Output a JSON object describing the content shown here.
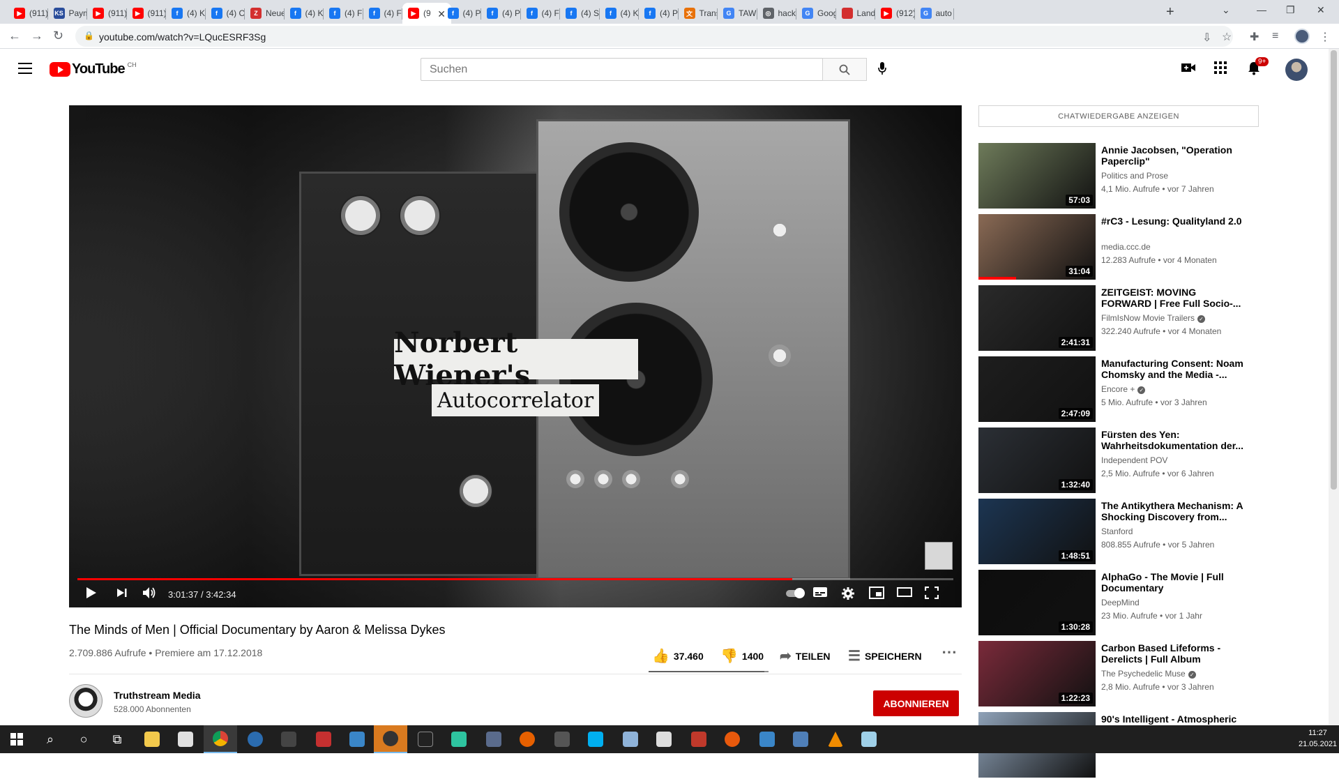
{
  "browser": {
    "tabs": [
      {
        "label": "(911)",
        "icon": "youtube",
        "color": "#ff0000"
      },
      {
        "label": "Paym",
        "icon": "ks",
        "color": "#2a4d9b"
      },
      {
        "label": "(911)",
        "icon": "youtube",
        "color": "#ff0000"
      },
      {
        "label": "(911)",
        "icon": "youtube",
        "color": "#ff0000"
      },
      {
        "label": "(4) Kı",
        "icon": "facebook",
        "color": "#1877f2"
      },
      {
        "label": "(4) Cı",
        "icon": "facebook",
        "color": "#1877f2"
      },
      {
        "label": "Neue",
        "icon": "z",
        "color": "#d32f2f"
      },
      {
        "label": "(4) Kı",
        "icon": "facebook",
        "color": "#1877f2"
      },
      {
        "label": "(4) Fa",
        "icon": "facebook",
        "color": "#1877f2"
      },
      {
        "label": "(4) Fa",
        "icon": "facebook",
        "color": "#1877f2"
      },
      {
        "label": "(9",
        "icon": "youtube",
        "color": "#ff0000",
        "active": true
      },
      {
        "label": "(4) Ps",
        "icon": "facebook",
        "color": "#1877f2"
      },
      {
        "label": "(4) Ps",
        "icon": "facebook",
        "color": "#1877f2"
      },
      {
        "label": "(4) Fı",
        "icon": "facebook",
        "color": "#1877f2"
      },
      {
        "label": "(4) Sc",
        "icon": "facebook",
        "color": "#1877f2"
      },
      {
        "label": "(4) Kı",
        "icon": "facebook",
        "color": "#1877f2"
      },
      {
        "label": "(4) Ps",
        "icon": "facebook",
        "color": "#1877f2"
      },
      {
        "label": "Trans",
        "icon": "translate",
        "color": "#e8710a"
      },
      {
        "label": "TAWI",
        "icon": "google",
        "color": "#4285f4"
      },
      {
        "label": "hack",
        "icon": "web",
        "color": "#5f6368"
      },
      {
        "label": "Goog",
        "icon": "gtranslate",
        "color": "#4285f4"
      },
      {
        "label": "Land",
        "icon": "flag",
        "color": "#d32f2f"
      },
      {
        "label": "(912)",
        "icon": "youtube",
        "color": "#ff0000"
      },
      {
        "label": "auto",
        "icon": "google",
        "color": "#4285f4"
      }
    ],
    "new_tab": "+",
    "url": "youtube.com/watch?v=LQucESRF3Sg"
  },
  "header": {
    "logo_text": "YouTube",
    "country_code": "CH",
    "search_placeholder": "Suchen",
    "notification_badge": "9+"
  },
  "player": {
    "overlay_title": "Norbert Wiener's",
    "overlay_subtitle": "Autocorrelator",
    "current_time": "3:01:37",
    "duration": "3:42:34",
    "time_display": "3:01:37 / 3:42:34",
    "progress_fraction": 0.816
  },
  "video": {
    "title": "The Minds of Men | Official Documentary by Aaron & Melissa Dykes",
    "meta": "2.709.886 Aufrufe • Premiere am 17.12.2018",
    "likes": "37.460",
    "dislikes": "1400",
    "share_label": "TEILEN",
    "save_label": "SPEICHERN",
    "like_fraction": 0.964
  },
  "channel": {
    "name": "Truthstream Media",
    "subscribers": "528.000 Abonnenten",
    "subscribe_label": "ABONNIEREN"
  },
  "sidebar": {
    "chat_replay_label": "CHATWIEDERGABE ANZEIGEN",
    "recommendations": [
      {
        "title": "Annie Jacobsen, \"Operation Paperclip\"",
        "channel": "Politics and Prose",
        "verified": false,
        "meta": "4,1 Mio. Aufrufe • vor 7 Jahren",
        "duration": "57:03",
        "thumb_color": "#6e7b5a",
        "watched_fraction": 0
      },
      {
        "title": "#rC3 - Lesung: Qualityland 2.0",
        "channel": "media.ccc.de",
        "verified": false,
        "meta": "12.283 Aufrufe • vor 4 Monaten",
        "duration": "31:04",
        "thumb_color": "#8a6a55",
        "watched_fraction": 0.32
      },
      {
        "title": "ZEITGEIST: MOVING FORWARD | Free Full Socio-...",
        "channel": "FilmIsNow Movie Trailers",
        "verified": true,
        "meta": "322.240 Aufrufe • vor 4 Monaten",
        "duration": "2:41:31",
        "thumb_color": "#2a2a2a",
        "watched_fraction": 0
      },
      {
        "title": "Manufacturing Consent: Noam Chomsky and the Media -...",
        "channel": "Encore +",
        "verified": true,
        "meta": "5 Mio. Aufrufe • vor 3 Jahren",
        "duration": "2:47:09",
        "thumb_color": "#1e1e1e",
        "watched_fraction": 0
      },
      {
        "title": "Fürsten des Yen: Wahrheitsdokumentation der...",
        "channel": "Independent POV",
        "verified": false,
        "meta": "2,5 Mio. Aufrufe • vor 6 Jahren",
        "duration": "1:32:40",
        "thumb_color": "#2b2f35",
        "watched_fraction": 0
      },
      {
        "title": "The Antikythera Mechanism: A Shocking Discovery from...",
        "channel": "Stanford",
        "verified": false,
        "meta": "808.855 Aufrufe • vor 5 Jahren",
        "duration": "1:48:51",
        "thumb_color": "#1c3552",
        "watched_fraction": 0
      },
      {
        "title": "AlphaGo - The Movie | Full Documentary",
        "channel": "DeepMind",
        "verified": false,
        "meta": "23 Mio. Aufrufe • vor 1 Jahr",
        "duration": "1:30:28",
        "thumb_color": "#0d0d0d",
        "watched_fraction": 0
      },
      {
        "title": "Carbon Based Lifeforms - Derelicts | Full Album",
        "channel": "The Psychedelic Muse",
        "verified": true,
        "meta": "2,8 Mio. Aufrufe • vor 3 Jahren",
        "duration": "1:22:23",
        "thumb_color": "#7a2a3a",
        "watched_fraction": 0
      },
      {
        "title": "90's Intelligent - Atmospheric",
        "channel": "",
        "verified": false,
        "meta": "",
        "duration": "",
        "thumb_color": "#8fa2b8",
        "watched_fraction": 0
      }
    ]
  },
  "taskbar": {
    "time": "11:27",
    "date": "21.05.2021"
  }
}
